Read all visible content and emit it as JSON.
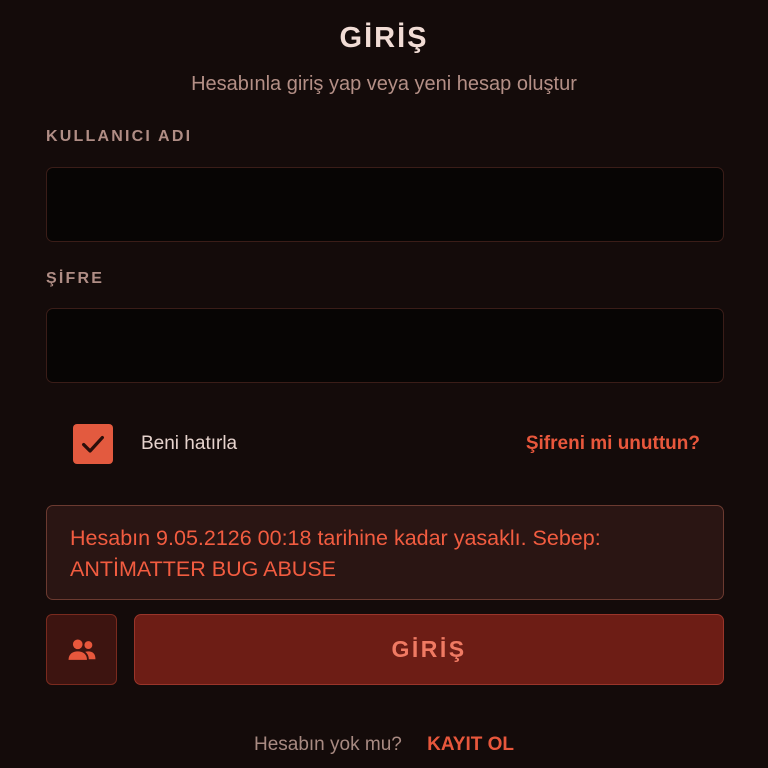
{
  "header": {
    "title": "GİRİŞ",
    "subtitle": "Hesabınla giriş yap veya yeni hesap oluştur"
  },
  "form": {
    "username_label": "KULLANICI ADI",
    "username_value": "",
    "password_label": "ŞİFRE",
    "password_value": "",
    "remember_label": "Beni hatırla",
    "remember_checked": true,
    "forgot_label": "Şifreni mi unuttun?"
  },
  "error": {
    "message": "Hesabın 9.05.2126 00:18 tarihine kadar yasaklı. Sebep: ANTİMATTER BUG ABUSE"
  },
  "actions": {
    "account_icon": "people-icon",
    "login_label": "GİRİŞ"
  },
  "footer": {
    "no_account_text": "Hesabın yok mu?",
    "register_label": "KAYIT OL"
  },
  "colors": {
    "background": "#140b0a",
    "accent": "#e8573c",
    "error_text": "#f25c40",
    "login_button": "#6d1d15"
  }
}
